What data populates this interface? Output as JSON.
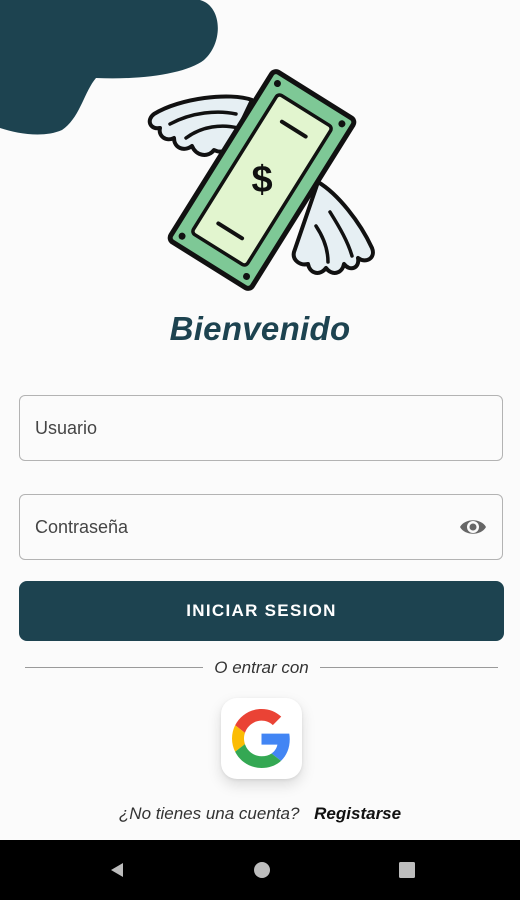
{
  "header": {
    "title": "Bienvenido"
  },
  "form": {
    "username_placeholder": "Usuario",
    "password_placeholder": "Contraseña",
    "login_button": "INICIAR SESION"
  },
  "social": {
    "divider_text": "O entrar con",
    "google_icon": "google-icon"
  },
  "signup": {
    "question": "¿No tienes una cuenta?",
    "link": "Registarse"
  },
  "navigation": {
    "back_icon": "back-triangle-icon",
    "home_icon": "home-circle-icon",
    "recents_icon": "recents-square-icon"
  },
  "colors": {
    "primary": "#1d4350",
    "bill_green": "#7ec896",
    "bill_inner": "#e2f5cf",
    "background": "#fbfbfb"
  }
}
